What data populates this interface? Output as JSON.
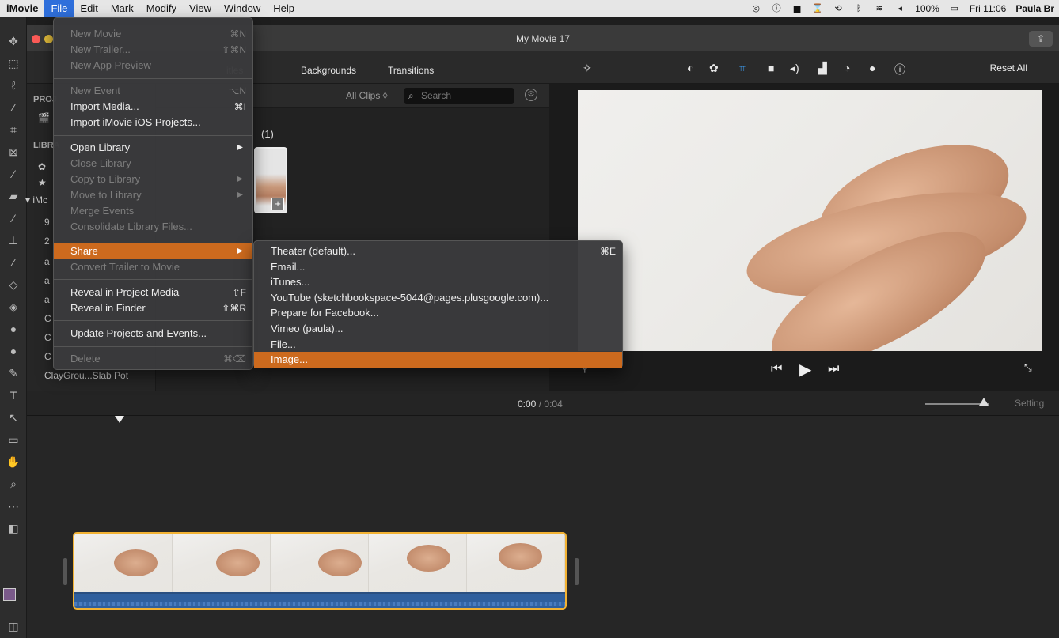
{
  "menubar": {
    "app": "iMovie",
    "items": [
      "File",
      "Edit",
      "Mark",
      "Modify",
      "View",
      "Window",
      "Help"
    ],
    "status": {
      "battery": "100%",
      "clock": "Fri 11:06",
      "user": "Paula Br"
    }
  },
  "window": {
    "title": "My Movie 17"
  },
  "browser": {
    "tabs": {
      "titles": "itles",
      "backgrounds": "Backgrounds",
      "transitions": "Transitions"
    },
    "filter": "All Clips",
    "search_placeholder": "Search",
    "event_count": "(1)"
  },
  "viewer": {
    "reset_all": "Reset All"
  },
  "library": {
    "projects_header": "PROJ",
    "libraries_header": "LIBRA",
    "library_name": "iMc",
    "rows": [
      "9",
      "2",
      "a",
      "a",
      "a",
      "C",
      "C",
      "C"
    ],
    "last_item": "ClayGrou...Slab Pot"
  },
  "timeline": {
    "current": "0:00",
    "separator": "/",
    "total": "0:04",
    "settings": "Setting"
  },
  "file_menu": [
    {
      "label": "New Movie",
      "shortcut": "⌘N",
      "disabled": true
    },
    {
      "label": "New Trailer...",
      "shortcut": "⇧⌘N",
      "disabled": true
    },
    {
      "label": "New App Preview",
      "shortcut": "",
      "disabled": true
    },
    {
      "label": "New Event",
      "shortcut": "⌥N",
      "disabled": true
    },
    {
      "label": "Import Media...",
      "shortcut": "⌘I",
      "disabled": false
    },
    {
      "label": "Import iMovie iOS Projects...",
      "shortcut": "",
      "disabled": false
    },
    {
      "label": "Open Library",
      "shortcut": "",
      "disabled": false
    },
    {
      "label": "Close Library",
      "shortcut": "",
      "disabled": true
    },
    {
      "label": "Copy to Library",
      "shortcut": "",
      "disabled": true
    },
    {
      "label": "Move to Library",
      "shortcut": "",
      "disabled": true
    },
    {
      "label": "Merge Events",
      "shortcut": "",
      "disabled": true
    },
    {
      "label": "Consolidate Library Files...",
      "shortcut": "",
      "disabled": true
    },
    {
      "label": "Share",
      "shortcut": "",
      "disabled": false
    },
    {
      "label": "Convert Trailer to Movie",
      "shortcut": "",
      "disabled": true
    },
    {
      "label": "Reveal in Project Media",
      "shortcut": "⇧F",
      "disabled": false
    },
    {
      "label": "Reveal in Finder",
      "shortcut": "⇧⌘R",
      "disabled": false
    },
    {
      "label": "Update Projects and Events...",
      "shortcut": "",
      "disabled": false
    },
    {
      "label": "Delete",
      "shortcut": "⌘⌫",
      "disabled": true
    }
  ],
  "share_menu": [
    {
      "label": "Theater (default)...",
      "shortcut": "⌘E"
    },
    {
      "label": "Email...",
      "shortcut": ""
    },
    {
      "label": "iTunes...",
      "shortcut": ""
    },
    {
      "label": "YouTube (sketchbookspace-5044@pages.plusgoogle.com)...",
      "shortcut": ""
    },
    {
      "label": "Prepare for Facebook...",
      "shortcut": ""
    },
    {
      "label": "Vimeo (paula)...",
      "shortcut": ""
    },
    {
      "label": "File...",
      "shortcut": ""
    },
    {
      "label": "Image...",
      "shortcut": ""
    }
  ],
  "colors": {
    "highlight": "#cc6a1e",
    "clip_border": "#f2b233",
    "audio": "#2f5f9d"
  }
}
